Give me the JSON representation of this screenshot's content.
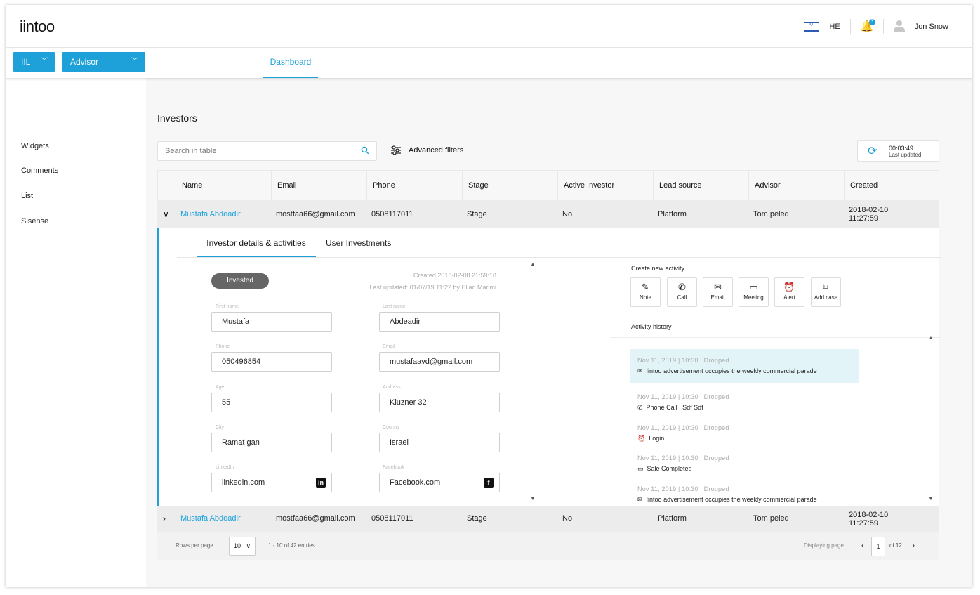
{
  "header": {
    "logo": "iintoo",
    "lang": "HE",
    "notification_count": "3",
    "username": "Jon Snow"
  },
  "nav": {
    "region_select": "IIL",
    "role_select": "Advisor",
    "tab_dashboard": "Dashboard"
  },
  "sidebar": {
    "items": [
      {
        "label": "Widgets"
      },
      {
        "label": "Comments"
      },
      {
        "label": "List"
      },
      {
        "label": "Sisense"
      }
    ]
  },
  "main": {
    "title": "Investors",
    "search_placeholder": "Search in table",
    "advanced_filters": "Advanced filters",
    "refresh_time": "00:03:49",
    "refresh_label": "Last updated"
  },
  "table": {
    "columns": [
      "Name",
      "Email",
      "Phone",
      "Stage",
      "Active Investor",
      "Lead source",
      "Advisor",
      "Created"
    ],
    "rows": [
      {
        "name": "Mustafa Abdeadir",
        "email": "mostfaa66@gmail.com",
        "phone": "0508117011",
        "stage": "Stage",
        "active": "No",
        "lead_source": "Platform",
        "advisor": "Tom peled",
        "created_date": "2018-02-10",
        "created_time": "11:27:59"
      },
      {
        "name": "Mustafa Abdeadir",
        "email": "mostfaa66@gmail.com",
        "phone": "0508117011",
        "stage": "Stage",
        "active": "No",
        "lead_source": "Platform",
        "advisor": "Tom peled",
        "created_date": "2018-02-10",
        "created_time": "11:27:59"
      }
    ]
  },
  "details": {
    "tab_details": "Investor details & activities",
    "tab_investments": "User Investments",
    "status": "Invested",
    "created": "Created 2018-02-08 21:59:18",
    "last_updated": "Last updated: 01/07/19 11:22 by Eliad Marimi",
    "fields": {
      "first_name_label": "First name",
      "first_name": "Mustafa",
      "last_name_label": "Last name",
      "last_name": "Abdeadir",
      "phone_label": "Phone",
      "phone": "050496854",
      "email_label": "Email",
      "email": "mustafaavd@gmail.com",
      "age_label": "Age",
      "age": "55",
      "address_label": "Address",
      "address": "Kluzner 32",
      "city_label": "City",
      "city": "Ramat gan",
      "country_label": "Country",
      "country": "Israel",
      "linkedin_label": "LinkedIn",
      "linkedin": "linkedin.com",
      "facebook_label": "Facebook",
      "facebook": "Facebook.com"
    },
    "create_activity_title": "Create new activity",
    "activities": [
      {
        "label": "Note",
        "icon": "note-icon"
      },
      {
        "label": "Call",
        "icon": "phone-icon"
      },
      {
        "label": "Email",
        "icon": "email-icon"
      },
      {
        "label": "Meeting",
        "icon": "calendar-icon"
      },
      {
        "label": "Alert",
        "icon": "alarm-icon"
      },
      {
        "label": "Add case",
        "icon": "case-icon"
      }
    ],
    "history_title": "Activity history",
    "history": [
      {
        "meta": "Nov 11,  2019  |  10:30  |  Dropped",
        "text": "Iintoo advertisement occupies the weekly commercial parade",
        "icon": "email-icon"
      },
      {
        "meta": "Nov 11,  2019  |  10:30  |  Dropped",
        "text": "Phone Call : Sdf Sdf",
        "icon": "phone-icon"
      },
      {
        "meta": "Nov 11,  2019  |  10:30  |  Dropped",
        "text": "Login",
        "icon": "alarm-icon"
      },
      {
        "meta": "Nov 11,  2019  |  10:30  |  Dropped",
        "text": "Sale Completed",
        "icon": "calendar-icon"
      },
      {
        "meta": "Nov 11,  2019  |  10:30  |  Dropped",
        "text": "Iintoo advertisement occupies the weekly commercial parade",
        "icon": "email-icon"
      }
    ]
  },
  "footer": {
    "rows_per_page_label": "Rows per page",
    "rows_per_page": "10",
    "entries": "1 - 10 of 42 entries",
    "displaying_label": "Displaying page",
    "current_page": "1",
    "of_pages": "of 12"
  },
  "colors": {
    "accent": "#1da1d8",
    "highlight": "#e3f4f9",
    "status_pill": "#666666"
  }
}
